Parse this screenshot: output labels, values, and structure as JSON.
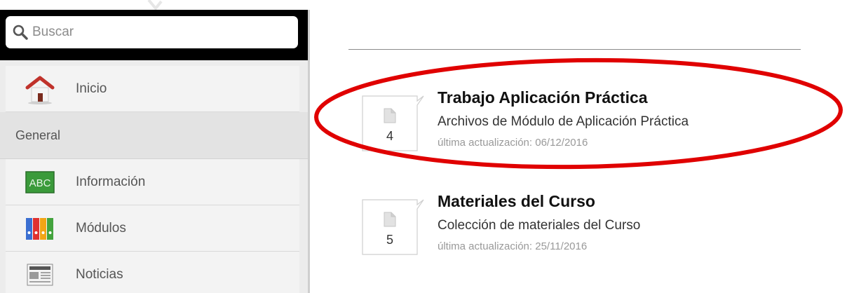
{
  "sidebar": {
    "search": {
      "placeholder": "Buscar",
      "icon": "search-icon"
    },
    "home": {
      "label": "Inicio",
      "icon": "home-icon"
    },
    "section_header": "General",
    "items": [
      {
        "label": "Información",
        "icon": "abc-board-icon"
      },
      {
        "label": "Módulos",
        "icon": "binders-icon"
      },
      {
        "label": "Noticias",
        "icon": "newspaper-icon"
      }
    ]
  },
  "folders": [
    {
      "title": "Trabajo Aplicación Práctica",
      "description": "Archivos de Módulo de Aplicación Práctica",
      "updated": "última actualización: 06/12/2016",
      "count": "4",
      "icon": "document-icon"
    },
    {
      "title": "Materiales del Curso",
      "description": "Colección de materiales del Curso",
      "updated": "última actualización: 25/11/2016",
      "count": "5",
      "icon": "document-icon"
    }
  ],
  "colors": {
    "highlight": "#e00000",
    "sidebar_bg": "#ececec",
    "search_bar_bg": "#000000",
    "abc_green": "#3a9a3a"
  }
}
